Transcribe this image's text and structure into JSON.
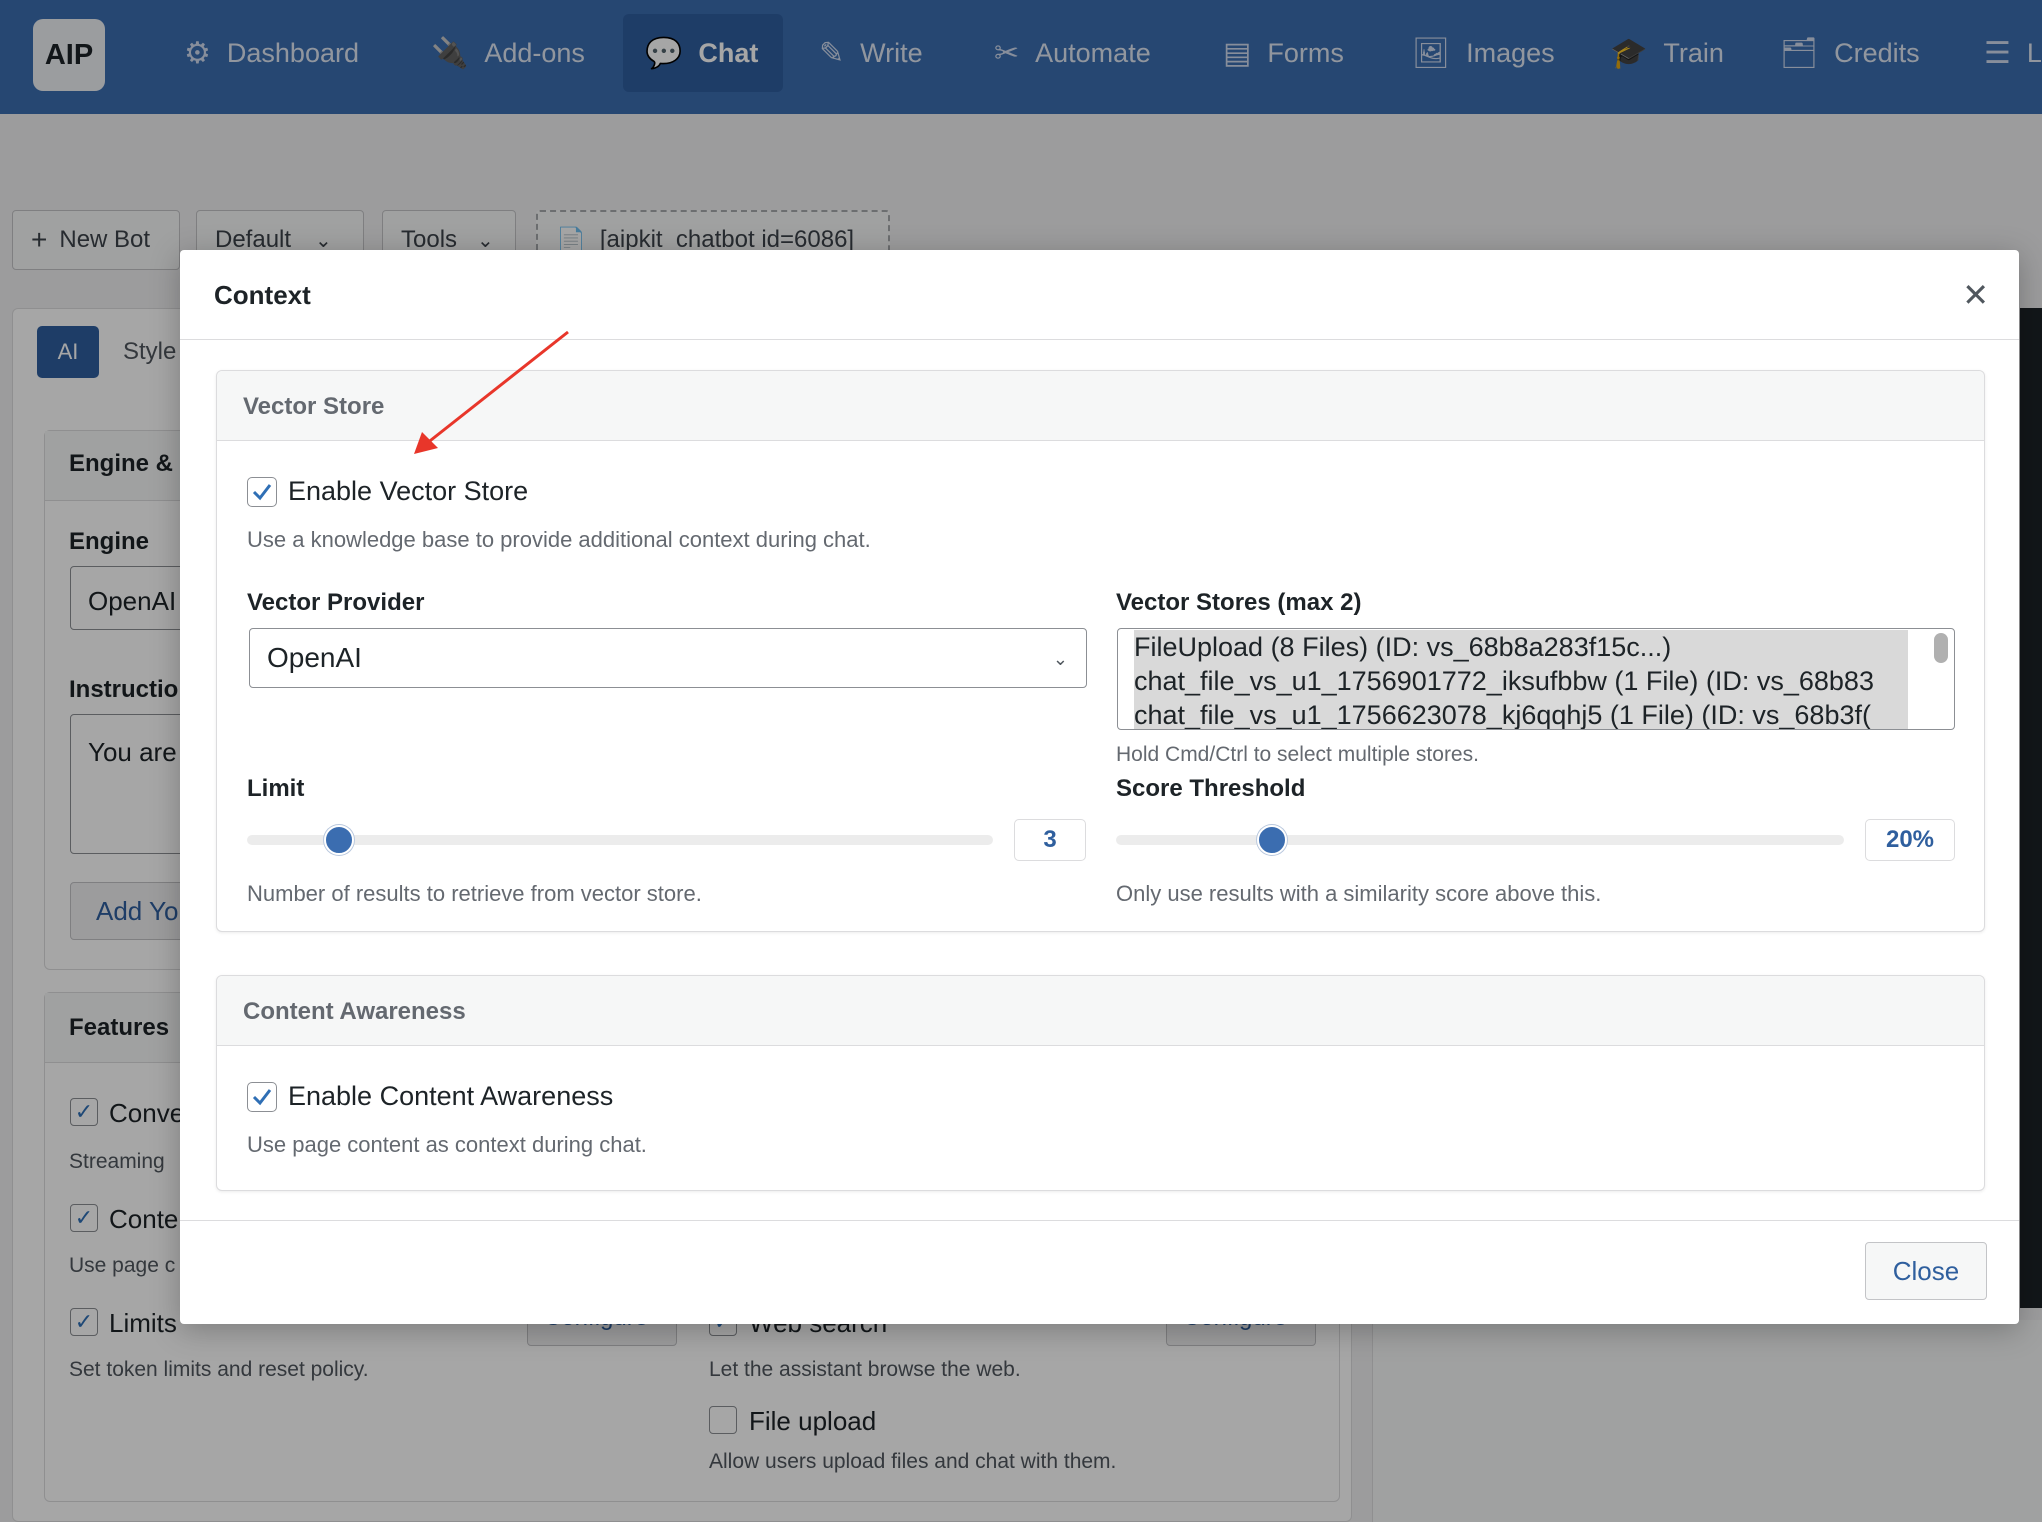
{
  "nav": {
    "logo": "AIP",
    "items": [
      {
        "label": "Dashboard",
        "icon": "⚙"
      },
      {
        "label": "Add-ons",
        "icon": "🔌"
      },
      {
        "label": "Chat",
        "icon": "💬"
      },
      {
        "label": "Write",
        "icon": "✎"
      },
      {
        "label": "Automate",
        "icon": "✂"
      },
      {
        "label": "Forms",
        "icon": "▤"
      },
      {
        "label": "Images",
        "icon": "🖼"
      },
      {
        "label": "Train",
        "icon": "🎓"
      },
      {
        "label": "Credits",
        "icon": "🗂"
      },
      {
        "label": "L",
        "icon": "☰"
      }
    ]
  },
  "toolbar": {
    "new_bot": "New Bot",
    "default": "Default",
    "tools": "Tools",
    "shortcode": "[aipkit_chatbot id=6086]"
  },
  "background": {
    "tab_ai": "AI",
    "tab_style": "Style",
    "engine_section": "Engine &",
    "engine_label": "Engine",
    "engine_value": "OpenAI",
    "instructions_label": "Instructio",
    "instructions_value": "You are",
    "add_button": "Add Yo",
    "features_section": "Features",
    "feat_conv": "Conve",
    "feat_streaming": "Streaming",
    "feat_content": "Conte",
    "feat_use_page": "Use page c",
    "feat_limits": "Limits",
    "feat_limits_desc": "Set token limits and reset policy.",
    "configure": "Configure",
    "web_search": "Web search",
    "web_search_desc": "Let the assistant browse the web.",
    "file_upload": "File upload",
    "file_upload_desc": "Allow users upload files and chat with them."
  },
  "modal": {
    "title": "Context",
    "close_label": "Close",
    "vector_store": {
      "section_title": "Vector Store",
      "enable_label": "Enable Vector Store",
      "enable_desc": "Use a knowledge base to provide additional context during chat.",
      "provider_label": "Vector Provider",
      "provider_value": "OpenAI",
      "stores_label": "Vector Stores (max 2)",
      "stores": [
        "FileUpload (8 Files) (ID: vs_68b8a283f15c...)",
        "chat_file_vs_u1_1756901772_iksufbbw (1 File) (ID: vs_68b83",
        "chat_file_vs_u1_1756623078_kj6qqhj5 (1 File) (ID: vs_68b3f("
      ],
      "stores_hint": "Hold Cmd/Ctrl to select multiple stores.",
      "limit_label": "Limit",
      "limit_value": "3",
      "limit_desc": "Number of results to retrieve from vector store.",
      "threshold_label": "Score Threshold",
      "threshold_value": "20%",
      "threshold_desc": "Only use results with a similarity score above this."
    },
    "content_awareness": {
      "section_title": "Content Awareness",
      "enable_label": "Enable Content Awareness",
      "enable_desc": "Use page content as context during chat."
    }
  },
  "colors": {
    "accent": "#3b6db0",
    "arrow": "#e8362a"
  }
}
